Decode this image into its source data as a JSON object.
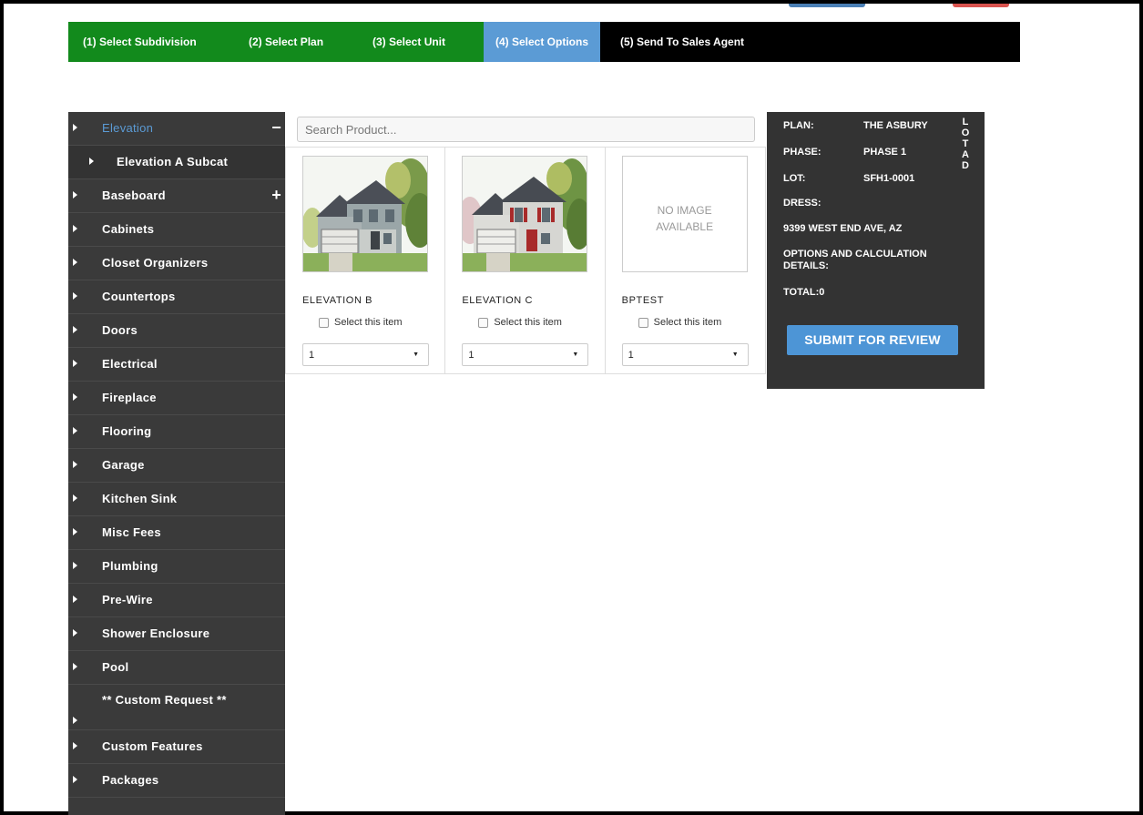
{
  "steps": [
    {
      "label": "(1) Select Subdivision"
    },
    {
      "label": "(2) Select Plan"
    },
    {
      "label": "(3) Select Unit"
    },
    {
      "label": "(4) Select Options"
    },
    {
      "label": "(5) Send To Sales Agent"
    }
  ],
  "sidebar": {
    "items": [
      {
        "label": "Elevation",
        "toggle": "−"
      },
      {
        "label": "Elevation A Subcat"
      },
      {
        "label": "Baseboard",
        "toggle": "+"
      },
      {
        "label": "Cabinets"
      },
      {
        "label": "Closet Organizers"
      },
      {
        "label": "Countertops"
      },
      {
        "label": "Doors"
      },
      {
        "label": "Electrical"
      },
      {
        "label": "Fireplace"
      },
      {
        "label": "Flooring"
      },
      {
        "label": "Garage"
      },
      {
        "label": "Kitchen Sink"
      },
      {
        "label": "Misc Fees"
      },
      {
        "label": "Plumbing"
      },
      {
        "label": "Pre-Wire"
      },
      {
        "label": "Shower Enclosure"
      },
      {
        "label": "Pool"
      },
      {
        "label": "** Custom Request **"
      },
      {
        "label": "Custom Features"
      },
      {
        "label": "Packages"
      }
    ]
  },
  "search": {
    "placeholder": "Search Product..."
  },
  "products": [
    {
      "name": "ELEVATION B",
      "select_label": "Select this item",
      "qty": "1",
      "icon": "house-elevation-b"
    },
    {
      "name": "ELEVATION C",
      "select_label": "Select this item",
      "qty": "1",
      "icon": "house-elevation-c"
    },
    {
      "name": "BPTEST",
      "select_label": "Select this item",
      "qty": "1",
      "no_image_line1": "NO IMAGE",
      "no_image_line2": "AVAILABLE"
    }
  ],
  "summary": {
    "plan_label": "PLAN:",
    "plan_value": "THE ASBURY",
    "phase_label": "PHASE:",
    "phase_value": "PHASE 1",
    "lot_label": "LOT:",
    "lot_value": "SFH1-0001",
    "dress_label": "DRESS:",
    "address_value": "9399 WEST END AVE, AZ",
    "options_label_1": "OPTIONS AND CALCULATION",
    "options_label_2": "DETAILS:",
    "total": "TOTAL:0",
    "vertical_letters": [
      "L",
      "O",
      "T",
      "A",
      "D"
    ],
    "submit_label": "SUBMIT FOR REVIEW"
  },
  "colors": {
    "step_done": "#128a1c",
    "step_active": "#5b9bd5",
    "sidebar_bg": "#3a3a3a",
    "accent": "#4d95d6"
  }
}
